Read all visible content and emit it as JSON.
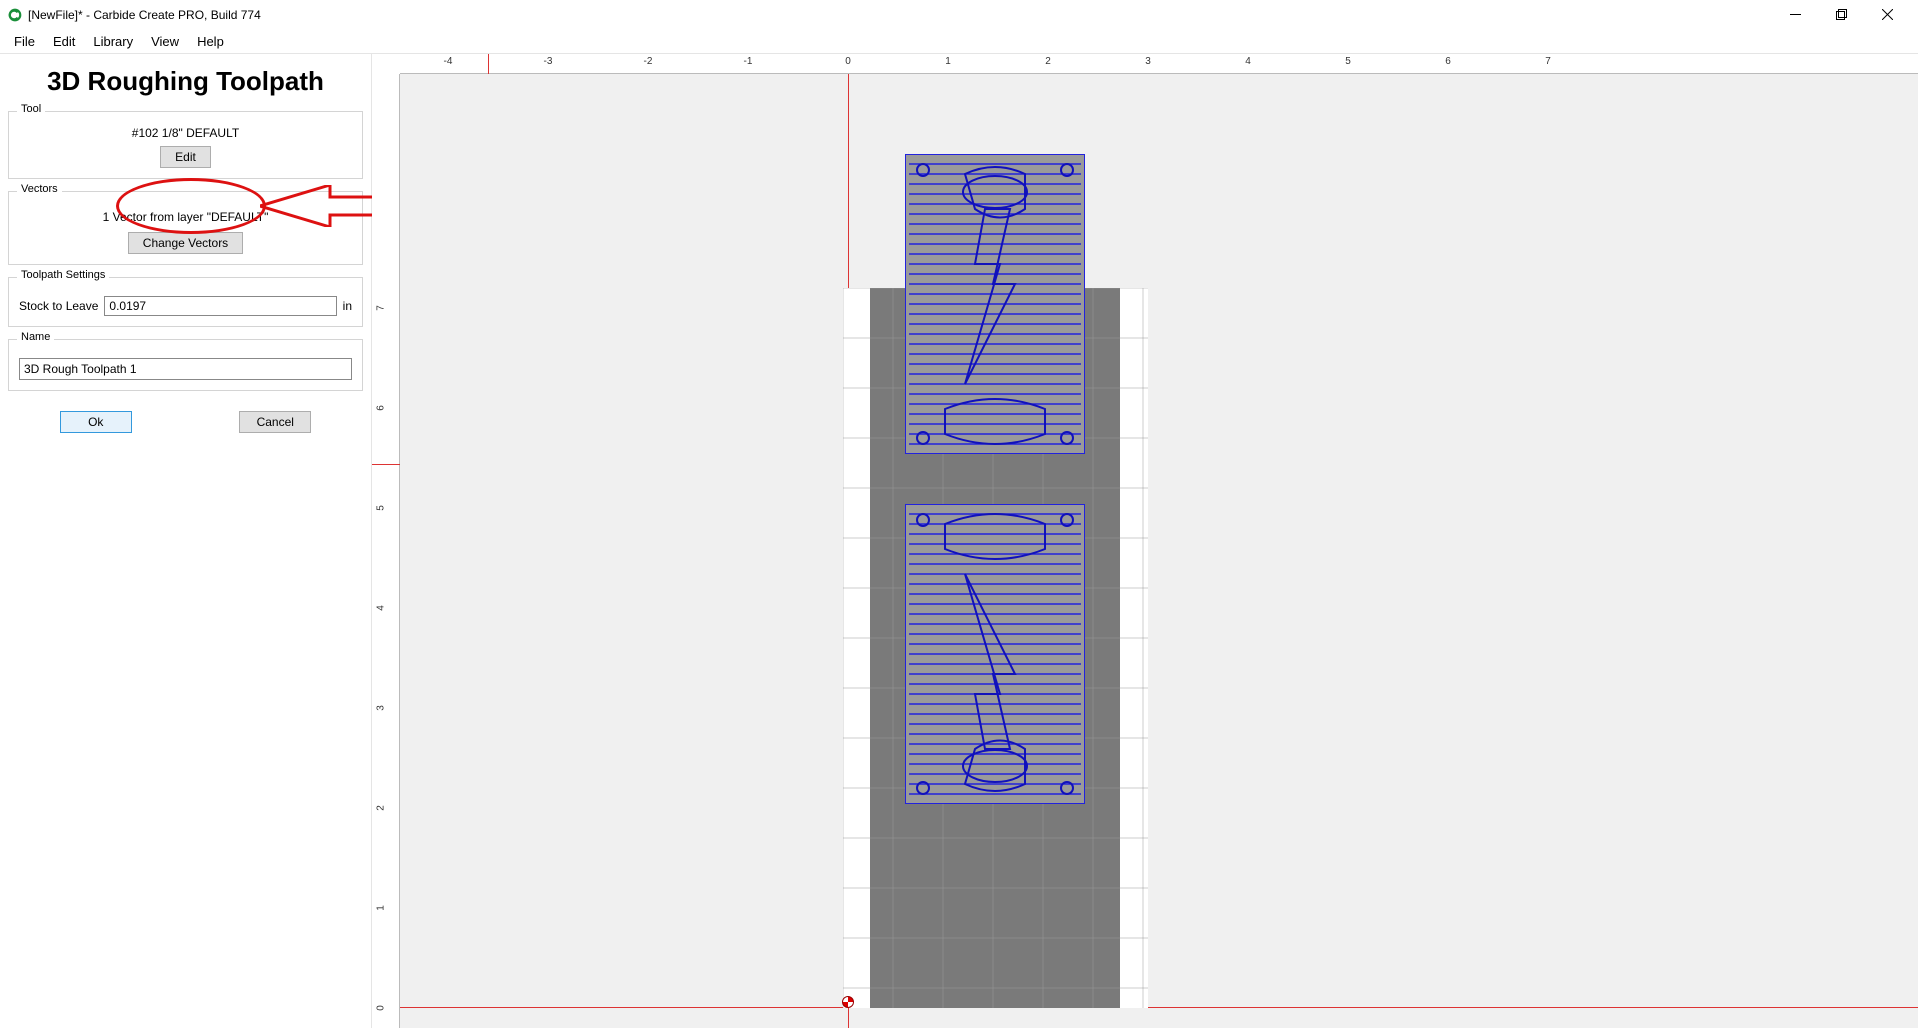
{
  "window": {
    "title": "[NewFile]* - Carbide Create PRO, Build 774"
  },
  "menu": [
    "File",
    "Edit",
    "Library",
    "View",
    "Help"
  ],
  "panel": {
    "title": "3D Roughing Toolpath",
    "tool": {
      "legend": "Tool",
      "tool_name": "#102 1/8\" DEFAULT",
      "edit_label": "Edit"
    },
    "vectors": {
      "legend": "Vectors",
      "info": "1 Vector from layer \"DEFAULT\"",
      "change_label": "Change Vectors"
    },
    "settings": {
      "legend": "Toolpath Settings",
      "stock_label": "Stock to Leave",
      "stock_value": "0.0197",
      "unit": "in"
    },
    "name": {
      "legend": "Name",
      "value": "3D Rough Toolpath 1"
    },
    "ok_label": "Ok",
    "cancel_label": "Cancel"
  },
  "ruler": {
    "h": [
      "-4",
      "-3",
      "-2",
      "-1",
      "0",
      "1",
      "2",
      "3",
      "4",
      "5",
      "6",
      "7"
    ],
    "v": [
      "0",
      "1",
      "2",
      "3",
      "4",
      "5",
      "6",
      "7"
    ]
  }
}
